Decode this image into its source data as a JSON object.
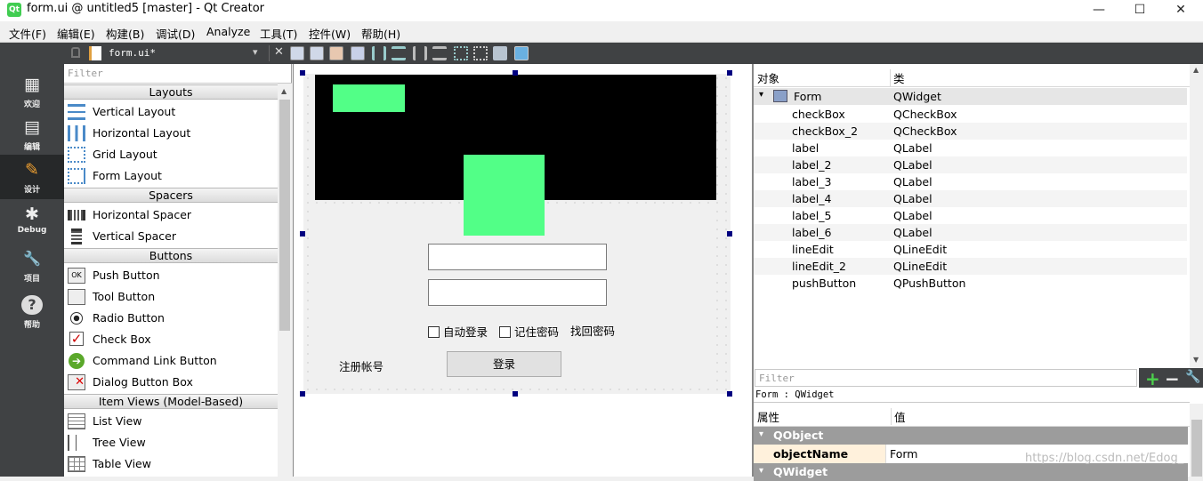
{
  "window": {
    "title": "form.ui @ untitled5 [master] - Qt Creator",
    "app_icon": "Qt",
    "minimize": "—",
    "maximize": "☐",
    "close": "✕"
  },
  "menu": [
    "文件(F)",
    "编辑(E)",
    "构建(B)",
    "调试(D)",
    "Analyze",
    "工具(T)",
    "控件(W)",
    "帮助(H)"
  ],
  "modes": [
    {
      "label": "欢迎",
      "icon": "grid-icon",
      "glyph": "▦"
    },
    {
      "label": "编辑",
      "icon": "document-icon",
      "glyph": "▤"
    },
    {
      "label": "设计",
      "icon": "pencil-icon",
      "glyph": "✎"
    },
    {
      "label": "Debug",
      "icon": "bug-icon",
      "glyph": "✱"
    },
    {
      "label": "项目",
      "icon": "wrench-icon",
      "glyph": "🔧"
    },
    {
      "label": "帮助",
      "icon": "help-icon",
      "glyph": "?"
    }
  ],
  "open_file": {
    "name": "form.ui*",
    "dropdown": "▾",
    "close": "✕"
  },
  "widget_box": {
    "filter_placeholder": "Filter",
    "categories": [
      {
        "name": "Layouts",
        "items": [
          "Vertical Layout",
          "Horizontal Layout",
          "Grid Layout",
          "Form Layout"
        ]
      },
      {
        "name": "Spacers",
        "items": [
          "Horizontal Spacer",
          "Vertical Spacer"
        ]
      },
      {
        "name": "Buttons",
        "items": [
          "Push Button",
          "Tool Button",
          "Radio Button",
          "Check Box",
          "Command Link Button",
          "Dialog Button Box"
        ]
      },
      {
        "name": "Item Views (Model-Based)",
        "items": [
          "List View",
          "Tree View",
          "Table View"
        ]
      }
    ]
  },
  "form_preview": {
    "line_edit_1": "",
    "line_edit_2": "",
    "checkbox_auto_login": "自动登录",
    "checkbox_remember": "记住密码",
    "link_forgot": "找回密码",
    "link_register": "注册帐号",
    "login_button": "登录"
  },
  "object_inspector": {
    "col_object": "对象",
    "col_class": "类",
    "root": {
      "name": "Form",
      "class": "QWidget"
    },
    "children": [
      {
        "name": "checkBox",
        "class": "QCheckBox"
      },
      {
        "name": "checkBox_2",
        "class": "QCheckBox"
      },
      {
        "name": "label",
        "class": "QLabel"
      },
      {
        "name": "label_2",
        "class": "QLabel"
      },
      {
        "name": "label_3",
        "class": "QLabel"
      },
      {
        "name": "label_4",
        "class": "QLabel"
      },
      {
        "name": "label_5",
        "class": "QLabel"
      },
      {
        "name": "label_6",
        "class": "QLabel"
      },
      {
        "name": "lineEdit",
        "class": "QLineEdit"
      },
      {
        "name": "lineEdit_2",
        "class": "QLineEdit"
      },
      {
        "name": "pushButton",
        "class": "QPushButton"
      }
    ]
  },
  "property_editor": {
    "filter_placeholder": "Filter",
    "add": "+",
    "remove": "−",
    "context": "Form : QWidget",
    "col_property": "属性",
    "col_value": "值",
    "group_qobject": "QObject",
    "prop_name": "objectName",
    "prop_value": "Form",
    "group_qwidget": "QWidget"
  },
  "watermark": "https://blog.csdn.net/Edog_",
  "colors": {
    "dark_bar": "#404244",
    "green_label": "#52ff87",
    "handle": "#000080",
    "group_bg": "#9c9c9c",
    "selected_prop": "#fff1dc"
  }
}
